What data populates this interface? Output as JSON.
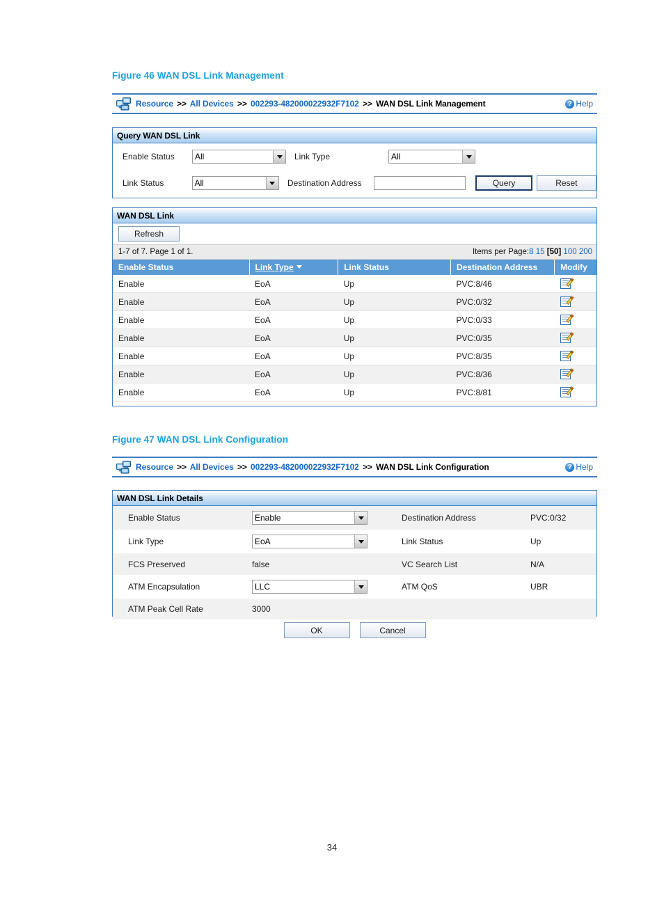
{
  "page": {
    "number": "34"
  },
  "figure46": {
    "caption": "Figure 46 WAN DSL Link Management",
    "breadcrumb": {
      "icon": "resource-devices-icon",
      "items": [
        "Resource",
        "All Devices",
        "002293-482000022932F7102",
        "WAN DSL Link Management"
      ],
      "separator": ">>",
      "help_label": "Help",
      "help_icon": "question-mark-icon"
    },
    "query_panel": {
      "title": "Query WAN DSL Link",
      "fields": {
        "enable_status_label": "Enable Status",
        "enable_status_value": "All",
        "link_type_label": "Link Type",
        "link_type_value": "All",
        "link_status_label": "Link Status",
        "link_status_value": "All",
        "destination_address_label": "Destination Address",
        "destination_address_value": "",
        "destination_address_placeholder": ""
      },
      "query_button": "Query",
      "reset_button": "Reset"
    },
    "list_panel": {
      "title": "WAN DSL Link",
      "refresh_button": "Refresh",
      "pager_text": "1-7 of 7. Page 1 of 1.",
      "items_per_page_label": "Items per Page:",
      "items_per_page_options": [
        "8",
        "15",
        "50",
        "100",
        "200"
      ],
      "items_per_page_current": "50",
      "columns": [
        "Enable Status",
        "Link Type",
        "Link Status",
        "Destination Address",
        "Modify"
      ],
      "sorted_column": "Link Type",
      "sort_direction": "desc",
      "rows": [
        {
          "enable_status": "Enable",
          "link_type": "EoA",
          "link_status": "Up",
          "destination_address": "PVC:8/46",
          "modify_icon": "edit-icon"
        },
        {
          "enable_status": "Enable",
          "link_type": "EoA",
          "link_status": "Up",
          "destination_address": "PVC:0/32",
          "modify_icon": "edit-icon"
        },
        {
          "enable_status": "Enable",
          "link_type": "EoA",
          "link_status": "Up",
          "destination_address": "PVC:0/33",
          "modify_icon": "edit-icon"
        },
        {
          "enable_status": "Enable",
          "link_type": "EoA",
          "link_status": "Up",
          "destination_address": "PVC:0/35",
          "modify_icon": "edit-icon"
        },
        {
          "enable_status": "Enable",
          "link_type": "EoA",
          "link_status": "Up",
          "destination_address": "PVC:8/35",
          "modify_icon": "edit-icon"
        },
        {
          "enable_status": "Enable",
          "link_type": "EoA",
          "link_status": "Up",
          "destination_address": "PVC:8/36",
          "modify_icon": "edit-icon"
        },
        {
          "enable_status": "Enable",
          "link_type": "EoA",
          "link_status": "Up",
          "destination_address": "PVC:8/81",
          "modify_icon": "edit-icon"
        }
      ]
    }
  },
  "figure47": {
    "caption": "Figure 47 WAN DSL Link Configuration",
    "breadcrumb": {
      "icon": "resource-devices-icon",
      "items": [
        "Resource",
        "All Devices",
        "002293-482000022932F7102",
        "WAN DSL Link Configuration"
      ],
      "separator": ">>",
      "help_label": "Help",
      "help_icon": "question-mark-icon"
    },
    "details_panel": {
      "title": "WAN DSL Link Details",
      "rows": [
        {
          "label": "Enable Status",
          "control": "select",
          "value": "Enable",
          "label2": "Destination Address",
          "value2": "PVC:0/32"
        },
        {
          "label": "Link Type",
          "control": "select",
          "value": "EoA",
          "label2": "Link Status",
          "value2": "Up"
        },
        {
          "label": "FCS Preserved",
          "control": "text",
          "value": "false",
          "label2": "VC Search List",
          "value2": "N/A"
        },
        {
          "label": "ATM Encapsulation",
          "control": "select",
          "value": "LLC",
          "label2": "ATM QoS",
          "value2": "UBR"
        },
        {
          "label": "ATM Peak Cell Rate",
          "control": "text",
          "value": "3000",
          "label2": "",
          "value2": ""
        }
      ],
      "ok_button": "OK",
      "cancel_button": "Cancel"
    }
  }
}
